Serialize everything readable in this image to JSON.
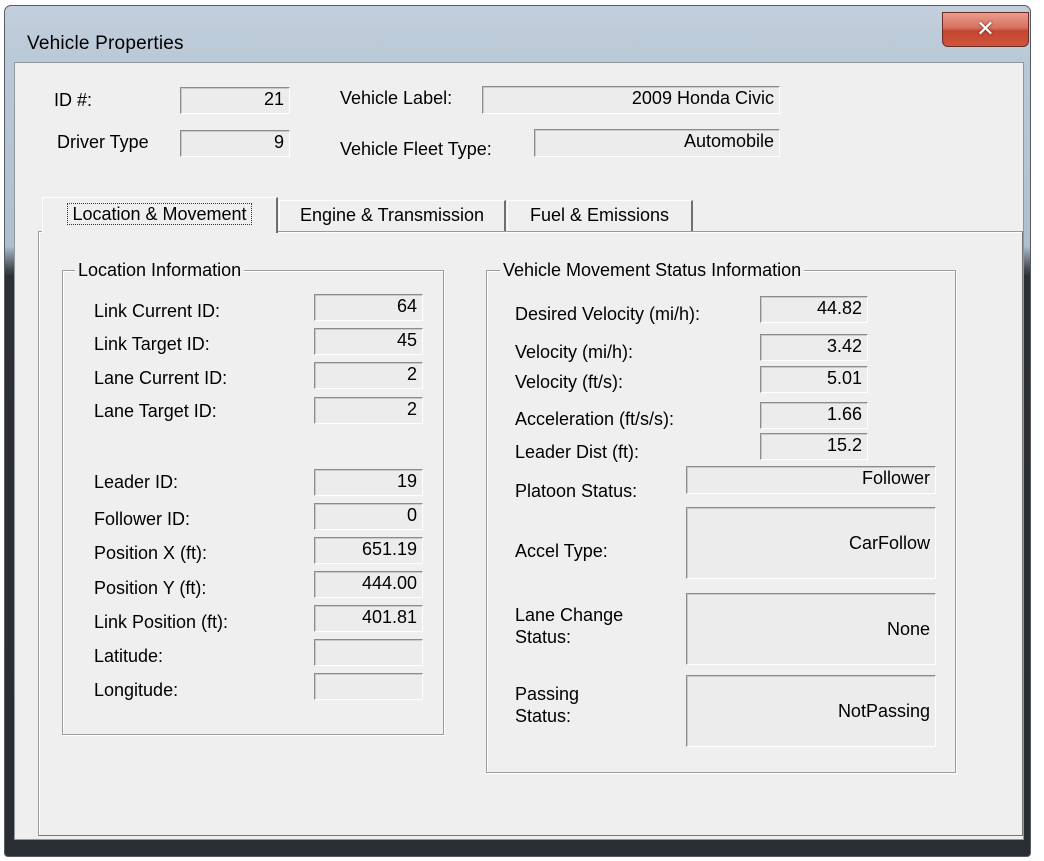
{
  "window": {
    "title": "Vehicle Properties",
    "close_glyph": "✕"
  },
  "header": {
    "id_label": "ID #:",
    "id_value": "21",
    "driver_type_label": "Driver Type",
    "driver_type_value": "9",
    "vehicle_label_label": "Vehicle Label:",
    "vehicle_label_value": "2009 Honda Civic",
    "fleet_type_label": "Vehicle Fleet Type:",
    "fleet_type_value": "Automobile"
  },
  "tabs": [
    {
      "label": "Location & Movement",
      "active": true
    },
    {
      "label": "Engine & Transmission",
      "active": false
    },
    {
      "label": "Fuel & Emissions",
      "active": false
    }
  ],
  "location": {
    "title": "Location Information",
    "rows": [
      {
        "label": "Link Current ID:",
        "value": "64"
      },
      {
        "label": "Link Target ID:",
        "value": "45"
      },
      {
        "label": "Lane Current ID:",
        "value": "2"
      },
      {
        "label": "Lane Target ID:",
        "value": "2"
      },
      {
        "label": "Leader ID:",
        "value": "19"
      },
      {
        "label": "Follower ID:",
        "value": "0"
      },
      {
        "label": "Position X (ft):",
        "value": "651.19"
      },
      {
        "label": "Position Y (ft):",
        "value": "444.00"
      },
      {
        "label": "Link Position (ft):",
        "value": "401.81"
      },
      {
        "label": "Latitude:",
        "value": ""
      },
      {
        "label": "Longitude:",
        "value": ""
      }
    ]
  },
  "movement": {
    "title": "Vehicle Movement Status Information",
    "desired_velocity_label": "Desired Velocity (mi/h):",
    "desired_velocity_value": "44.82",
    "velocity_mph_label": "Velocity (mi/h):",
    "velocity_mph_value": "3.42",
    "velocity_fts_label": "Velocity (ft/s):",
    "velocity_fts_value": "5.01",
    "acceleration_label": "Acceleration (ft/s/s):",
    "acceleration_value": "1.66",
    "leader_dist_label": "Leader Dist (ft):",
    "leader_dist_value": "15.2",
    "platoon_label": "Platoon Status:",
    "platoon_value": "Follower",
    "accel_type_label": "Accel Type:",
    "accel_type_value": "CarFollow",
    "lane_change_label_1": "Lane Change",
    "lane_change_label_2": "Status:",
    "lane_change_value": "None",
    "passing_label_1": "Passing",
    "passing_label_2": "Status:",
    "passing_value": "NotPassing"
  }
}
